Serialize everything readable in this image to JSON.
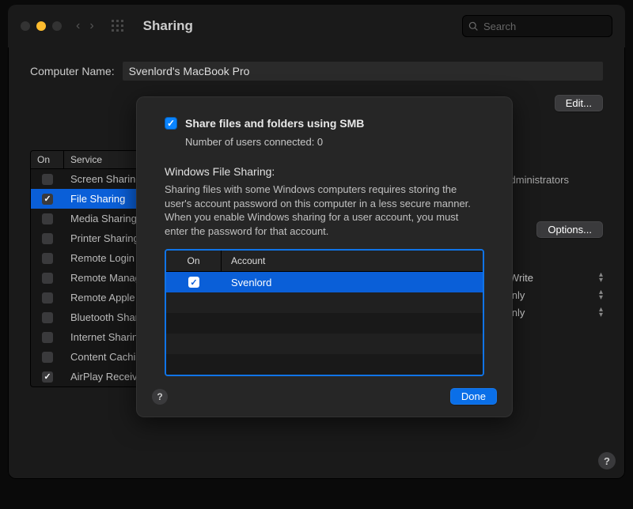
{
  "titlebar": {
    "title": "Sharing",
    "search_placeholder": "Search"
  },
  "computer_name": {
    "label": "Computer Name:",
    "value": "Svenlord's MacBook Pro",
    "edit_btn": "Edit..."
  },
  "services": {
    "head_on": "On",
    "head_service": "Service",
    "items": [
      {
        "on": false,
        "label": "Screen Sharing"
      },
      {
        "on": true,
        "label": "File Sharing",
        "selected": true
      },
      {
        "on": false,
        "label": "Media Sharing"
      },
      {
        "on": false,
        "label": "Printer Sharing"
      },
      {
        "on": false,
        "label": "Remote Login"
      },
      {
        "on": false,
        "label": "Remote Management"
      },
      {
        "on": false,
        "label": "Remote Apple Events"
      },
      {
        "on": false,
        "label": "Bluetooth Sharing"
      },
      {
        "on": false,
        "label": "Internet Sharing"
      },
      {
        "on": false,
        "label": "Content Caching"
      },
      {
        "on": true,
        "label": "AirPlay Receiver"
      }
    ]
  },
  "right": {
    "admins_text": "and administrators",
    "options_btn": "Options...",
    "perms": [
      {
        "label": "Read...Write"
      },
      {
        "label": "Read Only"
      },
      {
        "label": "Read Only"
      }
    ]
  },
  "sheet": {
    "smb_label": "Share files and folders using SMB",
    "connected": "Number of users connected: 0",
    "wfs_heading": "Windows File Sharing:",
    "wfs_desc": "Sharing files with some Windows computers requires storing the user's account password on this computer in a less secure manner. When you enable Windows sharing for a user account, you must enter the password for that account.",
    "acct_head_on": "On",
    "acct_head_acc": "Account",
    "accounts": [
      {
        "on": true,
        "name": "Svenlord",
        "selected": true
      }
    ],
    "done": "Done"
  }
}
